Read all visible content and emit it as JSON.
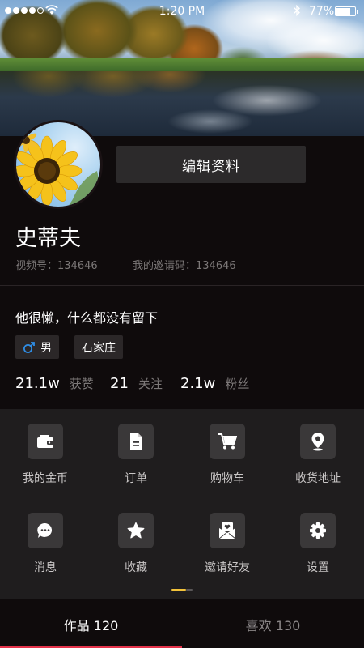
{
  "status_bar": {
    "time": "1:20 PM",
    "battery": "77%",
    "battery_level": 0.77,
    "signal_bars_filled": 4,
    "signal_bars_total": 5,
    "icons": [
      "signal-dots-icon",
      "wifi-icon",
      "bluetooth-icon",
      "battery-icon"
    ]
  },
  "profile": {
    "edit_button": "编辑资料",
    "name": "史蒂夫",
    "video_id": "视频号：134646",
    "invite_code": "我的邀请码：134646",
    "bio": "他很懒，什么都没有留下",
    "gender": "男",
    "gender_icon_color": "#2f8de4",
    "city": "石家庄"
  },
  "stats": [
    {
      "value": "21.1w",
      "label": "获赞"
    },
    {
      "value": "21",
      "label": "关注"
    },
    {
      "value": "2.1w",
      "label": "粉丝"
    }
  ],
  "grid": [
    {
      "label": "我的金币",
      "icon": "wallet-icon"
    },
    {
      "label": "订单",
      "icon": "document-icon"
    },
    {
      "label": "购物车",
      "icon": "cart-icon"
    },
    {
      "label": "收货地址",
      "icon": "location-pin-icon"
    },
    {
      "label": "消息",
      "icon": "chat-bubble-icon"
    },
    {
      "label": "收藏",
      "icon": "star-icon"
    },
    {
      "label": "邀请好友",
      "icon": "invite-envelope-icon"
    },
    {
      "label": "设置",
      "icon": "gear-icon"
    }
  ],
  "pager": {
    "pages": 2,
    "active": 1,
    "active_color": "#f2c23a"
  },
  "tabs": {
    "works": "作品 120",
    "likes": "喜欢 130",
    "active": "works",
    "underline_color": "#e5334b"
  }
}
